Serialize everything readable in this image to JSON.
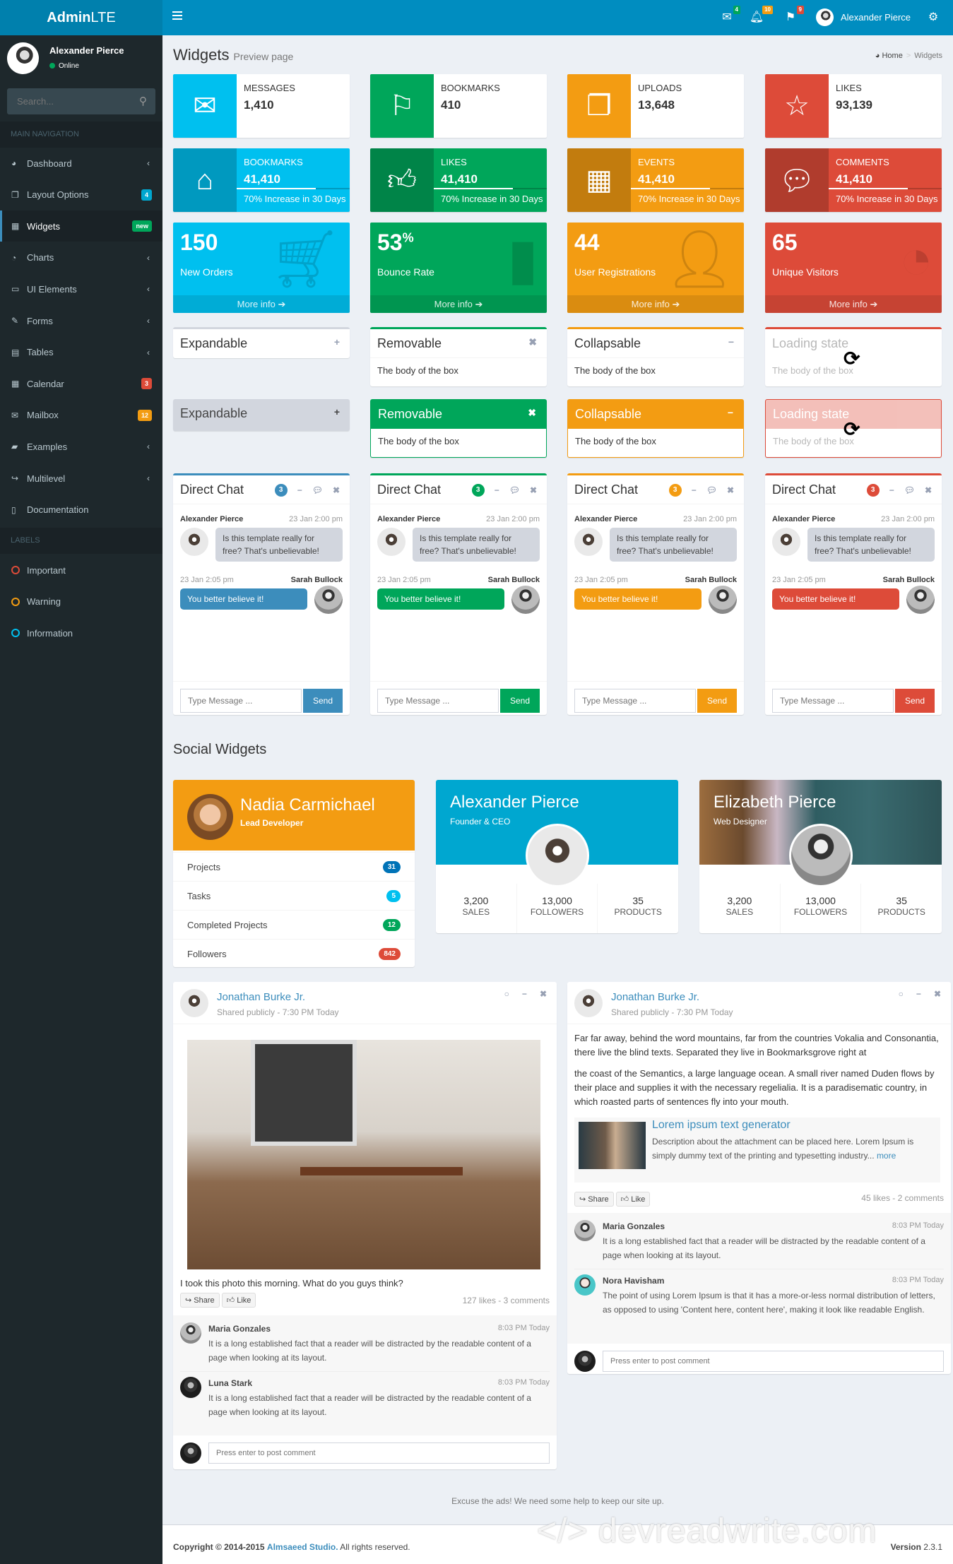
{
  "colors": {
    "aqua": "#00c0ef",
    "green": "#00a65a",
    "yellow": "#f39c12",
    "red": "#dd4b39",
    "blue": "#0073b7",
    "light_blue": "#3c8dbc"
  },
  "header": {
    "logo_bold": "Admin",
    "logo_light": "LTE",
    "messages_badge": "4",
    "notifications_badge": "10",
    "tasks_badge": "9",
    "user_name": "Alexander Pierce"
  },
  "sidebar": {
    "user_name": "Alexander Pierce",
    "user_status": "Online",
    "search_placeholder": "Search...",
    "main_header": "MAIN NAVIGATION",
    "items": [
      {
        "label": "Dashboard",
        "icon": "dashboard-icon",
        "chevron": true
      },
      {
        "label": "Layout Options",
        "icon": "files-icon",
        "badge": "4",
        "badge_color": "#00a7d0"
      },
      {
        "label": "Widgets",
        "icon": "grid-icon",
        "badge": "new",
        "badge_color": "#00a65a",
        "active": true
      },
      {
        "label": "Charts",
        "icon": "pie-chart-icon",
        "chevron": true
      },
      {
        "label": "UI Elements",
        "icon": "laptop-icon",
        "chevron": true
      },
      {
        "label": "Forms",
        "icon": "edit-icon",
        "chevron": true
      },
      {
        "label": "Tables",
        "icon": "table-icon",
        "chevron": true
      },
      {
        "label": "Calendar",
        "icon": "calendar-icon",
        "badge": "3",
        "badge_color": "#dd4b39"
      },
      {
        "label": "Mailbox",
        "icon": "envelope-icon",
        "badge": "12",
        "badge_color": "#f39c12"
      },
      {
        "label": "Examples",
        "icon": "folder-icon",
        "chevron": true
      },
      {
        "label": "Multilevel",
        "icon": "share-icon",
        "chevron": true
      },
      {
        "label": "Documentation",
        "icon": "book-icon"
      }
    ],
    "labels_header": "LABELS",
    "labels": [
      {
        "label": "Important",
        "color": "#dd4b39"
      },
      {
        "label": "Warning",
        "color": "#f39c12"
      },
      {
        "label": "Information",
        "color": "#00c0ef"
      }
    ]
  },
  "page": {
    "title": "Widgets",
    "subtitle": "Preview page"
  },
  "breadcrumb": {
    "home": "Home",
    "current": "Widgets"
  },
  "info_boxes": [
    {
      "label": "Messages",
      "value": "1,410",
      "icon": "envelope-icon"
    },
    {
      "label": "Bookmarks",
      "value": "410",
      "icon": "flag-icon"
    },
    {
      "label": "Uploads",
      "value": "13,648",
      "icon": "files-icon"
    },
    {
      "label": "Likes",
      "value": "93,139",
      "icon": "star-icon"
    }
  ],
  "info_boxes_filled": [
    {
      "label": "Bookmarks",
      "value": "41,410",
      "progress": 70,
      "desc": "70% Increase in 30 Days",
      "icon": "bookmark-icon"
    },
    {
      "label": "Likes",
      "value": "41,410",
      "progress": 70,
      "desc": "70% Increase in 30 Days",
      "icon": "thumbs-up-icon"
    },
    {
      "label": "Events",
      "value": "41,410",
      "progress": 70,
      "desc": "70% Increase in 30 Days",
      "icon": "calendar-icon"
    },
    {
      "label": "Comments",
      "value": "41,410",
      "progress": 70,
      "desc": "70% Increase in 30 Days",
      "icon": "comments-icon"
    }
  ],
  "small_boxes": [
    {
      "value": "150",
      "sup": "",
      "label": "New Orders",
      "footer": "More info",
      "icon": "cart-icon"
    },
    {
      "value": "53",
      "sup": "%",
      "label": "Bounce Rate",
      "footer": "More info",
      "icon": "bar-chart-icon"
    },
    {
      "value": "44",
      "sup": "",
      "label": "User Registrations",
      "footer": "More info",
      "icon": "user-add-icon"
    },
    {
      "value": "65",
      "sup": "",
      "label": "Unique Visitors",
      "footer": "More info",
      "icon": "pie-chart-icon"
    }
  ],
  "boxes": {
    "expandable": "Expandable",
    "removable": "Removable",
    "collapsable": "Collapsable",
    "loading": "Loading state",
    "body": "The body of the box"
  },
  "chat": {
    "title": "Direct Chat",
    "badge": "3",
    "msg1_name": "Alexander Pierce",
    "msg1_time": "23 Jan 2:00 pm",
    "msg1_text": "Is this template really for free? That's unbelievable!",
    "msg2_name": "Sarah Bullock",
    "msg2_time": "23 Jan 2:05 pm",
    "msg2_text": "You better believe it!",
    "placeholder": "Type Message ...",
    "send": "Send"
  },
  "social": {
    "title": "Social Widgets",
    "nadia": {
      "name": "Nadia Carmichael",
      "role": "Lead Developer",
      "items": [
        {
          "label": "Projects",
          "count": "31",
          "color": "#0073b7"
        },
        {
          "label": "Tasks",
          "count": "5",
          "color": "#00c0ef"
        },
        {
          "label": "Completed Projects",
          "count": "12",
          "color": "#00a65a"
        },
        {
          "label": "Followers",
          "count": "842",
          "color": "#dd4b39"
        }
      ]
    },
    "alexander": {
      "name": "Alexander Pierce",
      "role": "Founder & CEO"
    },
    "elizabeth": {
      "name": "Elizabeth Pierce",
      "role": "Web Designer"
    },
    "stats": [
      {
        "value": "3,200",
        "label": "Sales"
      },
      {
        "value": "13,000",
        "label": "Followers"
      },
      {
        "value": "35",
        "label": "Products"
      }
    ]
  },
  "posts": [
    {
      "author": "Jonathan Burke Jr.",
      "meta": "Shared publicly - 7:30 PM Today",
      "caption": "I took this photo this morning. What do you guys think?",
      "share": "Share",
      "like": "Like",
      "counts": "127 likes - 3 comments",
      "comments": [
        {
          "name": "Maria Gonzales",
          "time": "8:03 PM Today",
          "text": "It is a long established fact that a reader will be distracted by the readable content of a page when looking at its layout."
        },
        {
          "name": "Luna Stark",
          "time": "8:03 PM Today",
          "text": "It is a long established fact that a reader will be distracted by the readable content of a page when looking at its layout."
        }
      ],
      "comment_placeholder": "Press enter to post comment"
    },
    {
      "author": "Jonathan Burke Jr.",
      "meta": "Shared publicly - 7:30 PM Today",
      "para1": "Far far away, behind the word mountains, far from the countries Vokalia and Consonantia, there live the blind texts. Separated they live in Bookmarksgrove right at",
      "para2": "the coast of the Semantics, a large language ocean. A small river named Duden flows by their place and supplies it with the necessary regelialia. It is a paradisematic country, in which roasted parts of sentences fly into your mouth.",
      "attachment_title": "Lorem ipsum text generator",
      "attachment_text": "Description about the attachment can be placed here. Lorem Ipsum is simply dummy text of the printing and typesetting industry...",
      "attachment_more": "more",
      "share": "Share",
      "like": "Like",
      "counts": "45 likes - 2 comments",
      "comments": [
        {
          "name": "Maria Gonzales",
          "time": "8:03 PM Today",
          "text": "It is a long established fact that a reader will be distracted by the readable content of a page when looking at its layout."
        },
        {
          "name": "Nora Havisham",
          "time": "8:03 PM Today",
          "text": "The point of using Lorem Ipsum is that it has a more-or-less normal distribution of letters, as opposed to using 'Content here, content here', making it look like readable English."
        }
      ],
      "comment_placeholder": "Press enter to post comment"
    }
  ],
  "footer": {
    "ads": "Excuse the ads! We need some help to keep our site up.",
    "copyright_prefix": "Copyright © 2014-2015",
    "company": "Almsaeed Studio.",
    "rights": "All rights reserved.",
    "version_label": "Version",
    "version": "2.3.1",
    "watermark": "</> devreadwrite.com"
  }
}
